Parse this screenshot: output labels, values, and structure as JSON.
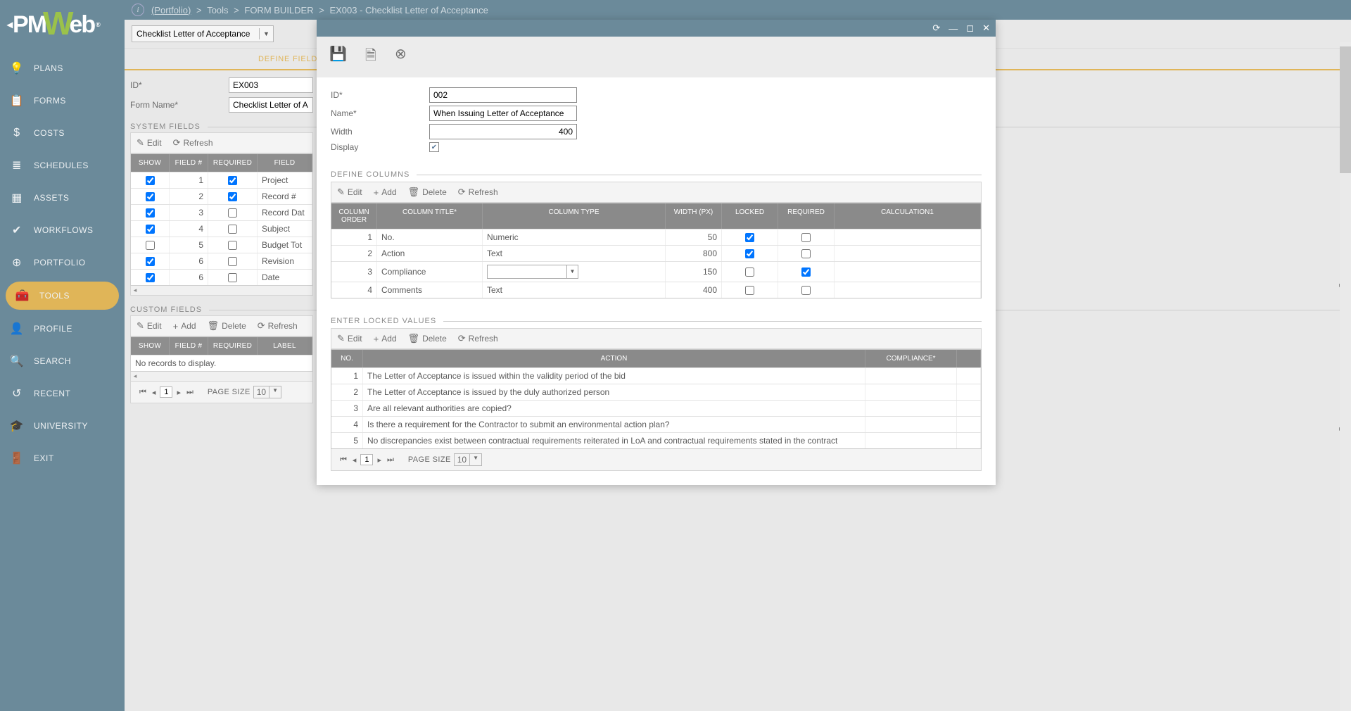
{
  "breadcrumb": [
    "(Portfolio)",
    "Tools",
    "FORM BUILDER",
    "EX003 - Checklist Letter of Acceptance"
  ],
  "subheaderSelect": "Checklist Letter of Acceptance",
  "mainTabs": {
    "defineFields": "DEFINE FIELDS"
  },
  "sidebar": {
    "items": [
      {
        "label": "PLANS",
        "icon": "💡"
      },
      {
        "label": "FORMS",
        "icon": "📋"
      },
      {
        "label": "COSTS",
        "icon": "$"
      },
      {
        "label": "SCHEDULES",
        "icon": "≣"
      },
      {
        "label": "ASSETS",
        "icon": "▦"
      },
      {
        "label": "WORKFLOWS",
        "icon": "✔"
      },
      {
        "label": "PORTFOLIO",
        "icon": "⊕"
      },
      {
        "label": "TOOLS",
        "icon": "🧰"
      },
      {
        "label": "PROFILE",
        "icon": "👤"
      },
      {
        "label": "SEARCH",
        "icon": "🔍"
      },
      {
        "label": "RECENT",
        "icon": "↺"
      },
      {
        "label": "UNIVERSITY",
        "icon": "🎓"
      },
      {
        "label": "EXIT",
        "icon": "🚪"
      }
    ]
  },
  "bgForm": {
    "idLabel": "ID*",
    "idValue": "EX003",
    "nameLabel": "Form Name*",
    "nameValue": "Checklist Letter of A"
  },
  "bgSections": {
    "system": "SYSTEM FIELDS",
    "custom": "CUSTOM FIELDS"
  },
  "toolbar": {
    "edit": "Edit",
    "add": "Add",
    "delete": "Delete",
    "refresh": "Refresh"
  },
  "sysCols": {
    "show": "SHOW",
    "fieldNo": "FIELD #",
    "required": "REQUIRED",
    "field": "FIELD"
  },
  "sysRows": [
    {
      "show": true,
      "no": "1",
      "req": true,
      "field": "Project"
    },
    {
      "show": true,
      "no": "2",
      "req": true,
      "field": "Record #"
    },
    {
      "show": true,
      "no": "3",
      "req": false,
      "field": "Record Dat"
    },
    {
      "show": true,
      "no": "4",
      "req": false,
      "field": "Subject"
    },
    {
      "show": false,
      "no": "5",
      "req": false,
      "field": "Budget Tot"
    },
    {
      "show": true,
      "no": "6",
      "req": false,
      "field": "Revision"
    },
    {
      "show": true,
      "no": "6",
      "req": false,
      "field": "Date"
    }
  ],
  "custCols": {
    "show": "SHOW",
    "fieldNo": "FIELD #",
    "required": "REQUIRED",
    "label": "LABEL"
  },
  "custEmpty": "No records to display.",
  "pager": {
    "page": "1",
    "pageSizeLabel": "PAGE SIZE",
    "pageSize": "10"
  },
  "modal": {
    "form": {
      "idLabel": "ID*",
      "id": "002",
      "nameLabel": "Name*",
      "name": "When Issuing Letter of Acceptance",
      "widthLabel": "Width",
      "width": "400",
      "displayLabel": "Display",
      "display": true
    },
    "sections": {
      "cols": "DEFINE COLUMNS",
      "locked": "ENTER LOCKED VALUES"
    },
    "colsHead": {
      "order": "COLUMN ORDER",
      "title": "COLUMN TITLE*",
      "type": "COLUMN TYPE",
      "width": "WIDTH (PX)",
      "locked": "LOCKED",
      "required": "REQUIRED",
      "calc": "CALCULATION1"
    },
    "colsRows": [
      {
        "o": "1",
        "t": "No.",
        "ty": "Numeric",
        "w": "50",
        "l": true,
        "r": false
      },
      {
        "o": "2",
        "t": "Action",
        "ty": "Text",
        "w": "800",
        "l": true,
        "r": false
      },
      {
        "o": "3",
        "t": "Compliance",
        "ty": "",
        "w": "150",
        "l": false,
        "r": true,
        "combo": true
      },
      {
        "o": "4",
        "t": "Comments",
        "ty": "Text",
        "w": "400",
        "l": false,
        "r": false
      }
    ],
    "lockedHead": {
      "no": "NO.",
      "action": "ACTION",
      "comp": "COMPLIANCE*"
    },
    "lockedRows": [
      {
        "n": "1",
        "a": "The Letter of Acceptance is issued within the validity period of the bid"
      },
      {
        "n": "2",
        "a": "The Letter of Acceptance is issued by the duly authorized person"
      },
      {
        "n": "3",
        "a": "Are all relevant authorities are copied?"
      },
      {
        "n": "4",
        "a": "Is there a requirement for the Contractor to submit an environmental action plan?"
      },
      {
        "n": "5",
        "a": "No discrepancies exist between contractual requirements reiterated in LoA and contractual requirements stated in the contract"
      }
    ]
  }
}
